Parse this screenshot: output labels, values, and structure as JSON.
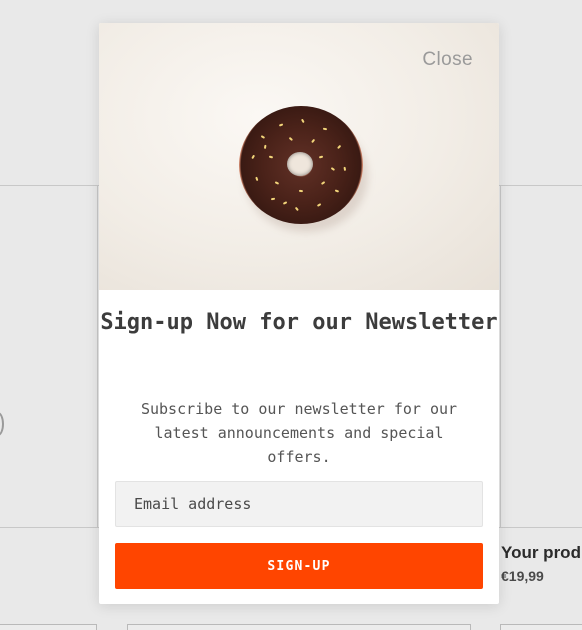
{
  "background": {
    "product": {
      "title": "Your product",
      "price": "€19,99"
    }
  },
  "modal": {
    "close_label": "Close",
    "hero_image_alt": "donut-image",
    "title": "Sign-up Now for our Newsletter",
    "description": "Subscribe to our newsletter for our latest announcements and special offers.",
    "email_placeholder": "Email address",
    "email_value": "",
    "submit_label": "SIGN-UP"
  },
  "colors": {
    "accent": "#ff4500",
    "page_background": "#e9e9e9",
    "modal_background": "#ffffff"
  }
}
